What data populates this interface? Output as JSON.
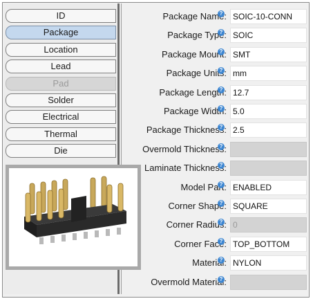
{
  "tabs": [
    {
      "label": "ID",
      "state": "normal"
    },
    {
      "label": "Package",
      "state": "active"
    },
    {
      "label": "Location",
      "state": "normal"
    },
    {
      "label": "Lead",
      "state": "normal"
    },
    {
      "label": "Pad",
      "state": "disabled"
    },
    {
      "label": "Solder",
      "state": "normal"
    },
    {
      "label": "Electrical",
      "state": "normal"
    },
    {
      "label": "Thermal",
      "state": "normal"
    },
    {
      "label": "Die",
      "state": "normal"
    }
  ],
  "preview": {
    "icon": "connector-header-image"
  },
  "properties": [
    {
      "label": "Package Name:",
      "value": "SOIC-10-CONN",
      "disabled": false
    },
    {
      "label": "Package Type:",
      "value": "SOIC",
      "disabled": false
    },
    {
      "label": "Package Mount:",
      "value": "SMT",
      "disabled": false
    },
    {
      "label": "Package Units:",
      "value": "mm",
      "disabled": false
    },
    {
      "label": "Package Length:",
      "value": "12.7",
      "disabled": false
    },
    {
      "label": "Package Width:",
      "value": "5.0",
      "disabled": false
    },
    {
      "label": "Package Thickness:",
      "value": "2.5",
      "disabled": false
    },
    {
      "label": "Overmold Thickness:",
      "value": "",
      "disabled": true
    },
    {
      "label": "Laminate Thickness:",
      "value": "",
      "disabled": true
    },
    {
      "label": "Model Part:",
      "value": "ENABLED",
      "disabled": false
    },
    {
      "label": "Corner Shape:",
      "value": "SQUARE",
      "disabled": false
    },
    {
      "label": "Corner Radius:",
      "value": "0",
      "disabled": true
    },
    {
      "label": "Corner Face:",
      "value": "TOP_BOTTOM",
      "disabled": false
    },
    {
      "label": "Material:",
      "value": "NYLON",
      "disabled": false
    },
    {
      "label": "Overmold Material:",
      "value": "",
      "disabled": true
    }
  ],
  "help_glyph": "?",
  "colors": {
    "active_tab": "#c4d8ee",
    "help_icon": "#3d86d1",
    "disabled_field": "#d3d3d3"
  }
}
